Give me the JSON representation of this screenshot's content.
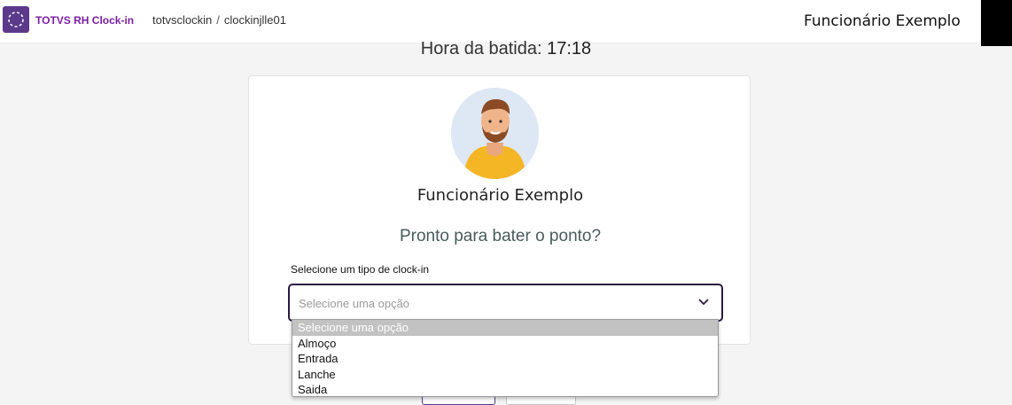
{
  "header": {
    "app_name": "TOTVS RH Clock-in",
    "breadcrumb": [
      "totvsclockin",
      "clockinjlle01"
    ],
    "breadcrumb_separator": "/",
    "user_name": "Funcionário Exemplo",
    "brand_color": "#7b1fa2"
  },
  "clock": {
    "label": "Hora da batida:",
    "time": "17:18"
  },
  "card": {
    "employee_name": "Funcionário Exemplo",
    "prompt": "Pronto para bater o ponto?",
    "select_label": "Selecione um tipo de clock-in",
    "select_placeholder": "Selecione uma opção",
    "options": [
      "Selecione uma opção",
      "Almoço",
      "Entrada",
      "Lanche",
      "Saida"
    ]
  }
}
